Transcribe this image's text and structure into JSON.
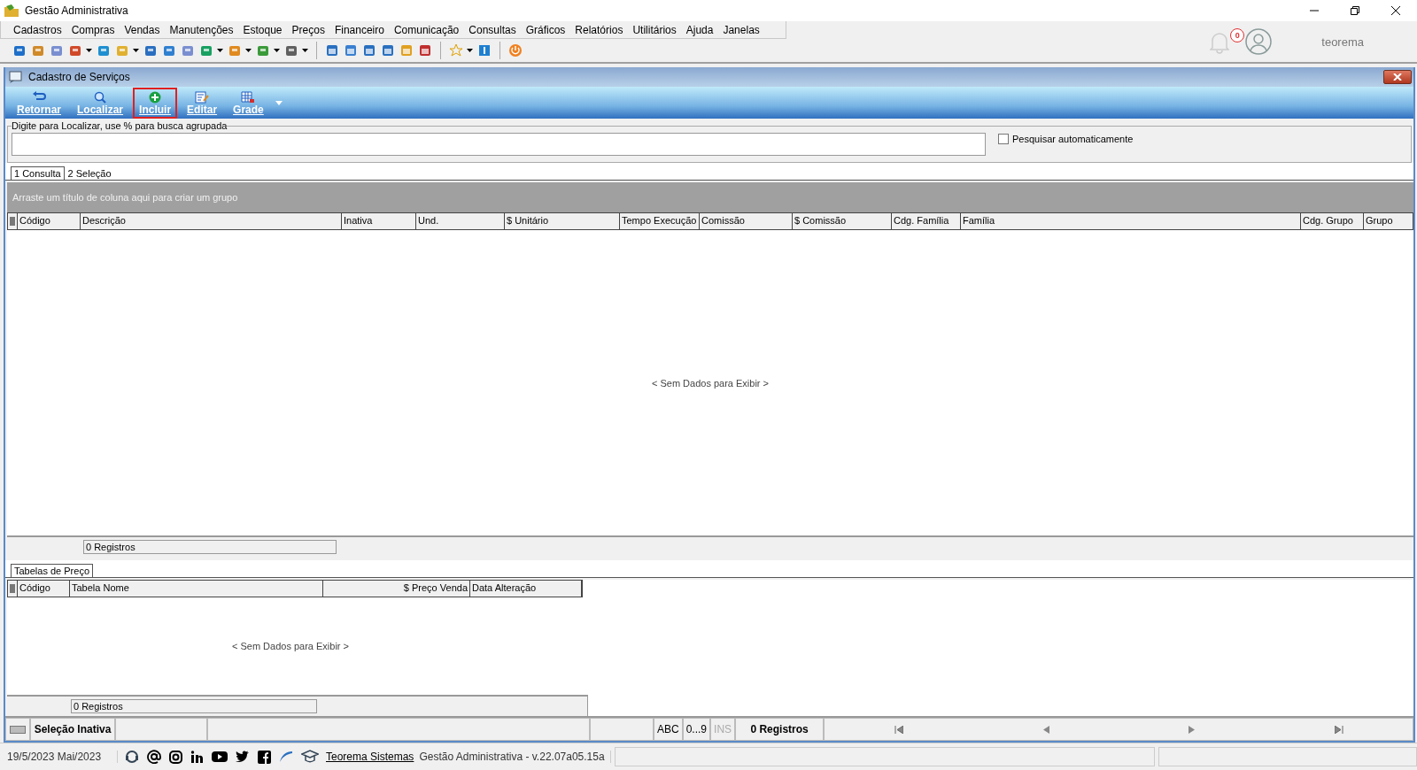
{
  "window": {
    "title": "Gestão Administrativa"
  },
  "menu": [
    "Cadastros",
    "Compras",
    "Vendas",
    "Manutenções",
    "Estoque",
    "Preços",
    "Financeiro",
    "Comunicação",
    "Consultas",
    "Gráficos",
    "Relatórios",
    "Utilitários",
    "Ajuda",
    "Janelas"
  ],
  "notifications": {
    "count": "0"
  },
  "user": {
    "name": "teorema"
  },
  "child_window": {
    "title": "Cadastro de Serviços"
  },
  "ribbon": [
    {
      "label": "Retornar",
      "kind": "back",
      "highlighted": false
    },
    {
      "label": "Localizar",
      "kind": "search",
      "highlighted": false
    },
    {
      "label": "Incluir",
      "kind": "add",
      "highlighted": true
    },
    {
      "label": "Editar",
      "kind": "edit",
      "highlighted": false
    },
    {
      "label": "Grade",
      "kind": "grid",
      "highlighted": false
    }
  ],
  "search": {
    "label": "Digite para Localizar, use % para busca agrupada",
    "auto_search": {
      "label": "Pesquisar automaticamente",
      "checked": false
    }
  },
  "tabs": [
    {
      "label": "1 Consulta",
      "selected": true
    },
    {
      "label": "2 Seleção",
      "selected": false
    }
  ],
  "group_panel": {
    "hint": "Arraste um título de coluna aqui para criar um grupo"
  },
  "table": {
    "columns": [
      "Código",
      "Descrição",
      "Inativa",
      "Und.",
      "$ Unitário",
      "Tempo Execução",
      "Comissão",
      "$ Comissão",
      "Cdg. Família",
      "Família",
      "Cdg. Grupo",
      "Grupo"
    ],
    "empty_message": "< Sem Dados para Exibir >",
    "footer": "0 Registros"
  },
  "detail_tabs": [
    {
      "label": "Tabelas de Preço",
      "selected": true
    }
  ],
  "detail_table": {
    "columns": [
      {
        "label": "Código",
        "kind": "text"
      },
      {
        "label": "Tabela Nome",
        "kind": "text"
      },
      {
        "label": "$ Preço Venda",
        "kind": "numeric"
      },
      {
        "label": "Data Alteração",
        "kind": "text"
      }
    ],
    "empty_message": "< Sem Dados para Exibir >",
    "footer": "0 Registros"
  },
  "status_bar": {
    "selection": "Seleção Inativa",
    "indicators": [
      {
        "label": "ABC",
        "disabled": false
      },
      {
        "label": "0...9",
        "disabled": false
      },
      {
        "label": "INS",
        "disabled": true
      }
    ],
    "records": "0 Registros"
  },
  "bottom_bar": {
    "date": "19/5/2023 Mai/2023",
    "link": "Teorema Sistemas",
    "version": "Gestão Administrativa - v.22.07a05.15a"
  }
}
